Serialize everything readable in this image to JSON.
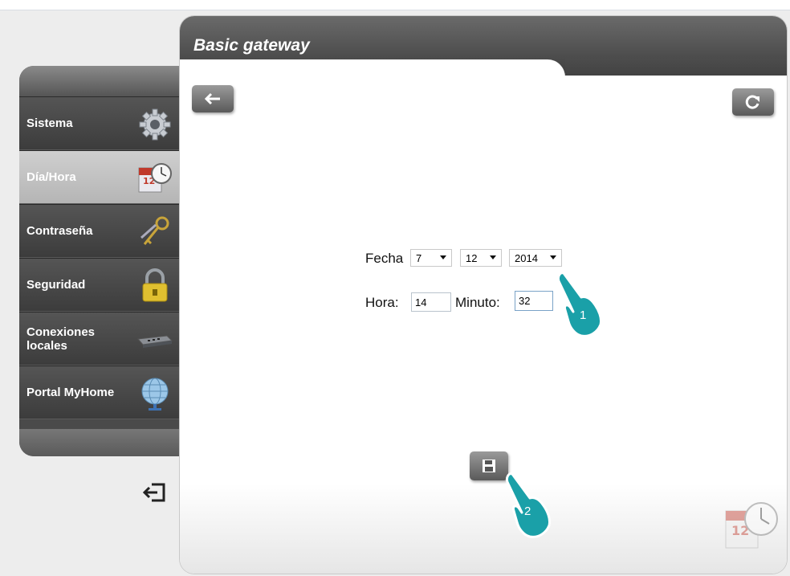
{
  "window": {
    "title": "Basic gateway"
  },
  "toolbar": {
    "back_icon": "arrow-left",
    "refresh_icon": "refresh",
    "save_icon": "floppy-disk"
  },
  "sidebar": {
    "items": [
      {
        "label": "Sistema",
        "icon": "gear-icon",
        "active": false
      },
      {
        "label": "Día/Hora",
        "icon": "calendar-clock-icon",
        "active": true
      },
      {
        "label": "Contraseña",
        "icon": "keys-icon",
        "active": false
      },
      {
        "label": "Seguridad",
        "icon": "padlock-icon",
        "active": false
      },
      {
        "label": "Conexiones locales",
        "icon": "network-switch-icon",
        "active": false
      },
      {
        "label": "Portal MyHome",
        "icon": "globe-icon",
        "active": false
      }
    ],
    "exit_icon": "exit-icon"
  },
  "form": {
    "date_label": "Fecha",
    "day_value": "7",
    "month_value": "12",
    "year_value": "2014",
    "hour_label": "Hora:",
    "hour_value": "14",
    "minute_label": "Minuto:",
    "minute_value": "32"
  },
  "callouts": {
    "step1": "1",
    "step2": "2"
  },
  "colors": {
    "header": "#4a4a4a",
    "active_item": "#c2c2c2",
    "button": "#6e6e6e"
  }
}
